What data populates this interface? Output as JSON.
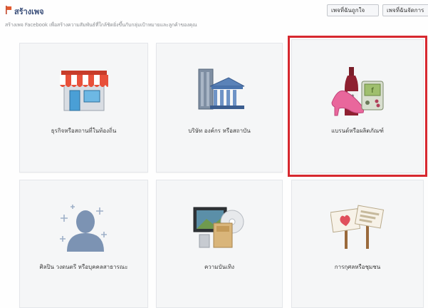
{
  "header": {
    "icon": "flag-icon",
    "title": "สร้างเพจ",
    "subtitle": "สร้างเพจ Facebook เพื่อสร้างความสัมพันธ์ที่ใกล้ชิดยิ่งขึ้นกับกลุ่มเป้าหมายและลูกค้าของคุณ"
  },
  "buttons": {
    "liked_pages": "เพจที่ฉันถูกใจ",
    "managed_pages": "เพจที่ฉันจัดการ"
  },
  "categories": [
    {
      "label": "ธุรกิจหรือสถานที่ในท้องถิ่น",
      "icon": "storefront-icon"
    },
    {
      "label": "บริษัท องค์กร หรือสถาบัน",
      "icon": "company-building-icon"
    },
    {
      "label": "แบรนด์หรือผลิตภัณฑ์",
      "icon": "brand-product-icon"
    },
    {
      "label": "ศิลปิน วงดนตรี หรือบุคคลสาธารณะ",
      "icon": "public-figure-icon"
    },
    {
      "label": "ความบันเทิง",
      "icon": "entertainment-icon"
    },
    {
      "label": "การกุศลหรือชุมชน",
      "icon": "community-signs-icon"
    }
  ],
  "colors": {
    "highlight": "#d7282f",
    "title": "#3b4f7a",
    "card_background": "#f5f6f7"
  }
}
